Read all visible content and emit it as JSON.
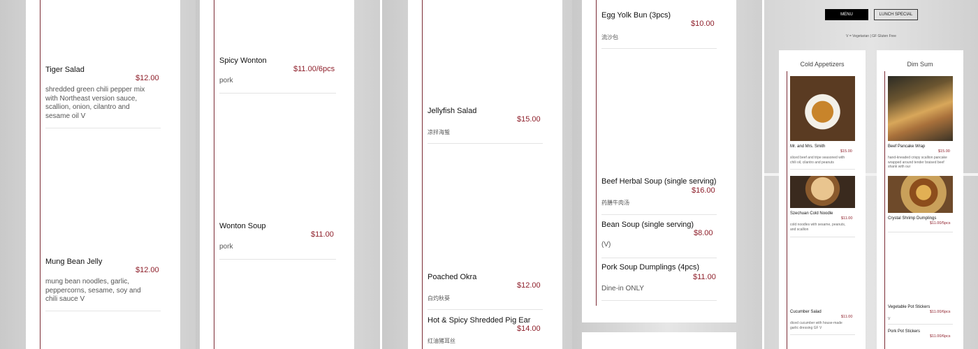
{
  "col1": {
    "items": [
      {
        "name": "Tiger Salad",
        "price": "$12.00",
        "desc": "shredded green chili pepper mix with Northeast version sauce, scallion, onion, cilantro and sesame oil V"
      },
      {
        "name": "Mung Bean Jelly",
        "price": "$12.00",
        "desc": "mung bean noodles, garlic, peppercorns, sesame, soy and chili sauce V"
      }
    ]
  },
  "col2": {
    "items": [
      {
        "name": "Spicy Wonton",
        "price": "$11.00/6pcs",
        "desc": "pork"
      },
      {
        "name": "Wonton Soup",
        "price": "$11.00",
        "desc": "pork"
      }
    ]
  },
  "col3": {
    "items": [
      {
        "name": "Jellyfish Salad",
        "price": "$15.00",
        "desc": "凉拌海蜇"
      },
      {
        "name": "Poached Okra",
        "price": "$12.00",
        "desc": "白灼秋葵"
      },
      {
        "name": "Hot & Spicy Shredded Pig Ear",
        "price": "$14.00",
        "desc": "红油猪耳丝"
      }
    ]
  },
  "col4": {
    "items": [
      {
        "name": "Egg Yolk Bun (3pcs)",
        "price": "$10.00",
        "desc": "流沙包"
      },
      {
        "name": "Beef Herbal Soup (single serving)",
        "price": "$16.00",
        "desc": "药膳牛肉汤"
      },
      {
        "name": "Bean Soup (single serving)",
        "price": "$8.00",
        "desc": "(V)"
      },
      {
        "name": "Pork Soup Dumplings (4pcs)",
        "price": "$11.00",
        "desc": "Dine-in ONLY"
      }
    ]
  },
  "right": {
    "buttons": {
      "menu": "MENU",
      "lunch": "LUNCH SPECIAL"
    },
    "legend": "V = Vegetarian | GF Gluten Free",
    "cold": {
      "title": "Cold Appetizers",
      "items": [
        {
          "name": "Mr. and Mrs. Smith",
          "price": "$15.00",
          "desc": "sliced beef and tripe seasoned with chili oil, cilantro and peanuts"
        },
        {
          "name": "Szechuan Cold Noodle",
          "price": "$11.00",
          "desc": "cold noodles with sesame, peanuts, and scallion"
        },
        {
          "name": "Cucumber Salad",
          "price": "$11.00",
          "desc": "diced cucumber with house-made garlic dressing GF V"
        }
      ]
    },
    "dimsum": {
      "title": "Dim Sum",
      "items": [
        {
          "name": "Beef Pancake Wrap",
          "price": "$15.00",
          "desc": "hand-kneaded crispy scallion pancake wrapped around tender braised beef shank with our"
        },
        {
          "name": "Crystal Shrimp Dumplings",
          "price": "$11.00/5pcs",
          "desc": ""
        },
        {
          "name": "Vegetable Pot Stickers",
          "price": "$11.00/6pcs",
          "desc": "V"
        },
        {
          "name": "Pork Pot Stickers",
          "price": "$11.00/6pcs",
          "desc": ""
        }
      ]
    }
  }
}
